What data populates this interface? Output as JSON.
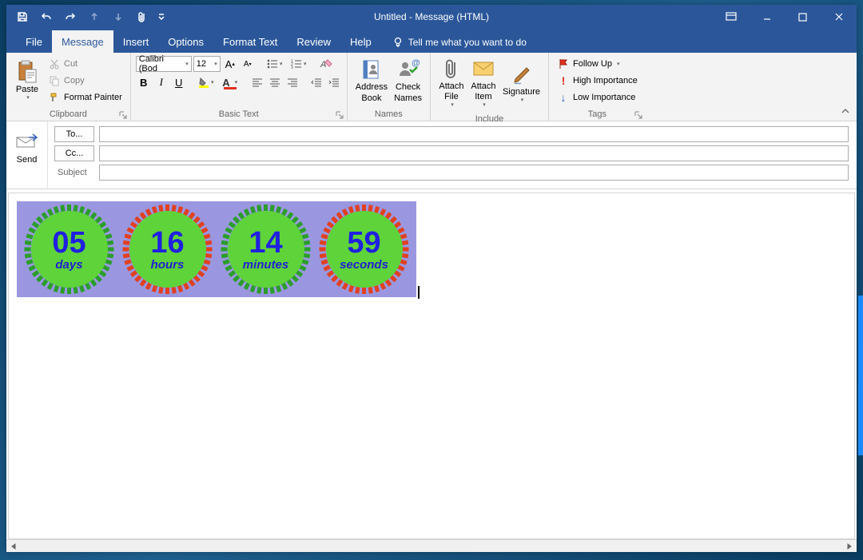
{
  "title": "Untitled  -  Message (HTML)",
  "tabs": {
    "file": "File",
    "message": "Message",
    "insert": "Insert",
    "options": "Options",
    "format": "Format Text",
    "review": "Review",
    "help": "Help"
  },
  "tellme": "Tell me what you want to do",
  "clipboard": {
    "paste": "Paste",
    "cut": "Cut",
    "copy": "Copy",
    "painter": "Format Painter",
    "label": "Clipboard"
  },
  "font": {
    "name": "Calibri (Bod",
    "size": "12",
    "label": "Basic Text"
  },
  "names": {
    "address": "Address Book",
    "check": "Check Names",
    "label": "Names"
  },
  "include": {
    "file": "Attach File",
    "item": "Attach Item",
    "sig": "Signature",
    "label": "Include"
  },
  "tags": {
    "follow": "Follow Up",
    "high": "High Importance",
    "low": "Low Importance",
    "label": "Tags"
  },
  "send": "Send",
  "fields": {
    "to": "To...",
    "cc": "Cc...",
    "subject": "Subject"
  },
  "countdown": {
    "days": {
      "value": "05",
      "label": "days",
      "color": "#2a9d2a"
    },
    "hours": {
      "value": "16",
      "label": "hours",
      "color": "#e04020"
    },
    "minutes": {
      "value": "14",
      "label": "minutes",
      "color": "#2a9d2a"
    },
    "seconds": {
      "value": "59",
      "label": "seconds",
      "color": "#e04020"
    }
  }
}
